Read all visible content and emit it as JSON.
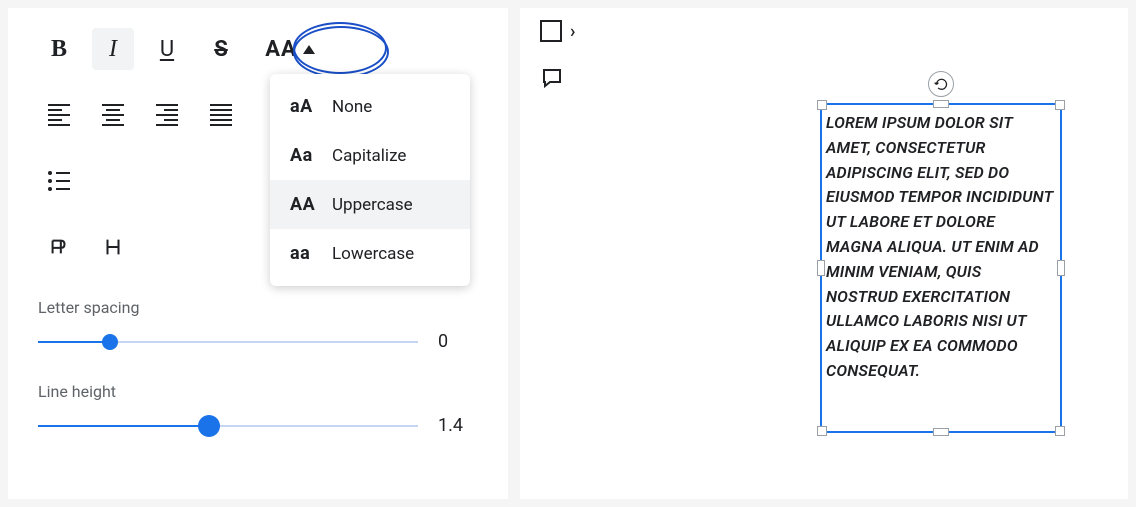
{
  "toolbar": {
    "bold": "B",
    "italic": "I",
    "underline": "U",
    "strike": "S",
    "case": "AA"
  },
  "case_menu": {
    "none": {
      "icon": "aA",
      "label": "None"
    },
    "capitalize": {
      "icon": "Aa",
      "label": "Capitalize"
    },
    "uppercase": {
      "icon": "AA",
      "label": "Uppercase"
    },
    "lowercase": {
      "icon": "aa",
      "label": "Lowercase"
    }
  },
  "sections": {
    "letter_spacing_label": "Letter spacing",
    "letter_spacing_value": "0",
    "line_height_label": "Line height",
    "line_height_value": "1.4"
  },
  "right_panel": {
    "expand_chevron": "›"
  },
  "canvas": {
    "text": "LOREM IPSUM DOLOR SIT AMET, CONSECTETUR ADIPISCING ELIT, SED DO EIUSMOD TEMPOR INCIDIDUNT UT LABORE ET DOLORE MAGNA ALIQUA. UT ENIM AD MINIM VENIAM, QUIS NOSTRUD EXERCITATION ULLAMCO LABORIS NISI UT ALIQUIP EX EA COMMODO CONSEQUAT."
  }
}
